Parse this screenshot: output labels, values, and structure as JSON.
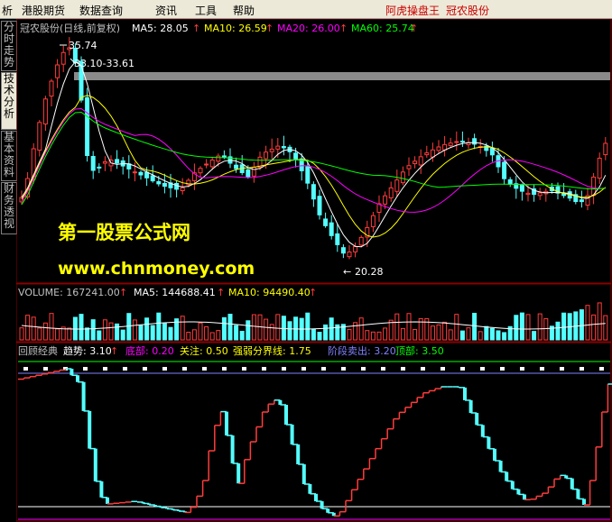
{
  "menu": {
    "items": [
      "析",
      "港股期货",
      "数据查询",
      "资讯",
      "工具",
      "帮助"
    ],
    "right_title": "阿虎操盘王",
    "right_stock": "冠农股份"
  },
  "side_tabs": [
    "分时走势",
    "技术分析",
    "基本资料",
    "财务透视"
  ],
  "main_panel": {
    "stock_title": "冠农股份(日线,前复权)",
    "ma5": "MA5: 28.05",
    "ma10": "MA10: 26.59",
    "ma20": "MA20: 26.00",
    "ma60": "MA60: 25.74",
    "high_label": "35.74",
    "range_label": "33.10-33.61",
    "low_label": "20.28",
    "watermark_cn": "第一股票公式网",
    "watermark_url": "www.chnmoney.com"
  },
  "volume_panel": {
    "volume": "VOLUME: 167241.00",
    "ma5": "MA5: 144688.41",
    "ma10": "MA10: 94490.40"
  },
  "indicator_panel": {
    "name": "回顾经典",
    "trend": "趋势: 3.10",
    "bottom": "底部: 0.20",
    "attention": "关注: 0.50",
    "strength": "强弱分界线: 1.75",
    "sell": "阶段卖出: 3.20",
    "top": "顶部: 3.50"
  },
  "colors": {
    "up": "#ff3c3c",
    "down": "#54ffff",
    "ma5": "#ffffff",
    "ma10": "#ffff00",
    "ma20": "#ff00ff",
    "ma60": "#00ff00",
    "menu_bg": "#ece9d8",
    "highlight": "#cc0000"
  }
}
